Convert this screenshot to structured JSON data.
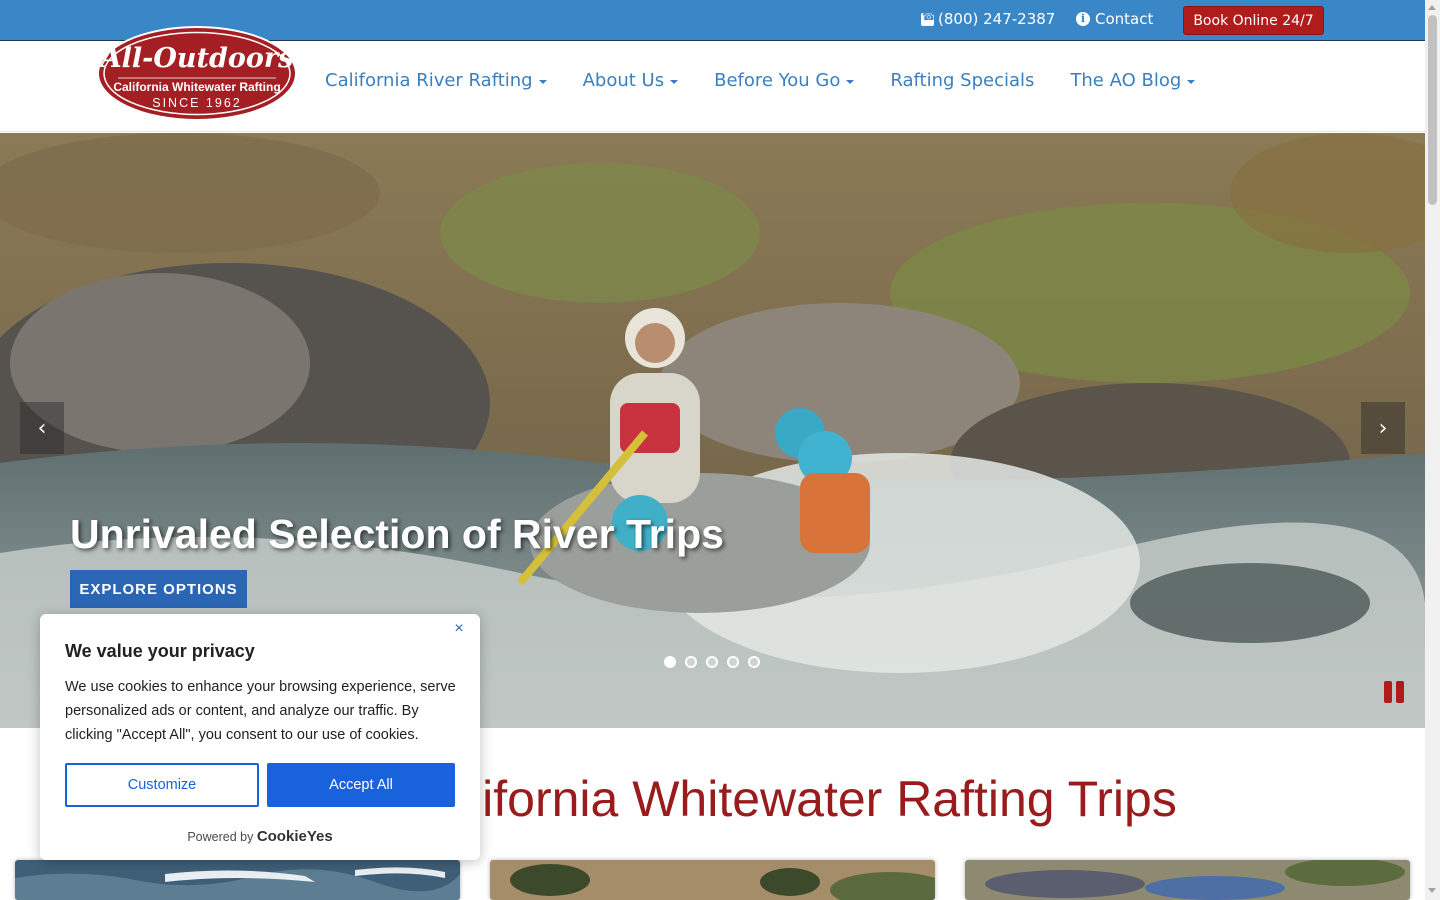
{
  "topbar": {
    "phone": "(800) 247-2387",
    "contact": "Contact",
    "book_button": "Book Online 24/7",
    "phone_icon": "phone-icon",
    "contact_icon": "info-circle-icon",
    "bar_color": "#3a87c8",
    "book_color": "#b01c1c"
  },
  "logo": {
    "line1": "All-Outdoors",
    "line2": "California Whitewater Rafting",
    "line3": "SINCE 1962"
  },
  "nav": {
    "items": [
      {
        "label": "California River Rafting",
        "has_dropdown": true
      },
      {
        "label": "About Us",
        "has_dropdown": true
      },
      {
        "label": "Before You Go",
        "has_dropdown": true
      },
      {
        "label": "Rafting Specials",
        "has_dropdown": false
      },
      {
        "label": "The AO Blog",
        "has_dropdown": true
      }
    ],
    "link_color": "#3a7fc1"
  },
  "hero": {
    "title": "Unrivaled Selection of River Trips",
    "button": "EXPLORE OPTIONS",
    "prev_label": "‹",
    "next_label": "›",
    "slide_count": 5,
    "active_slide": 1
  },
  "section": {
    "title": "California Whitewater Rafting Trips",
    "title_color": "#9a1b1b"
  },
  "cookie_banner": {
    "title": "We value your privacy",
    "body": "We use cookies to enhance your browsing experience, serve personalized ads or content, and analyze our traffic. By clicking \"Accept All\", you consent to our use of cookies.",
    "customize": "Customize",
    "accept": "Accept All",
    "powered_by": "Powered by",
    "brand": "CookieYes",
    "close": "×",
    "accent": "#1863dc"
  }
}
